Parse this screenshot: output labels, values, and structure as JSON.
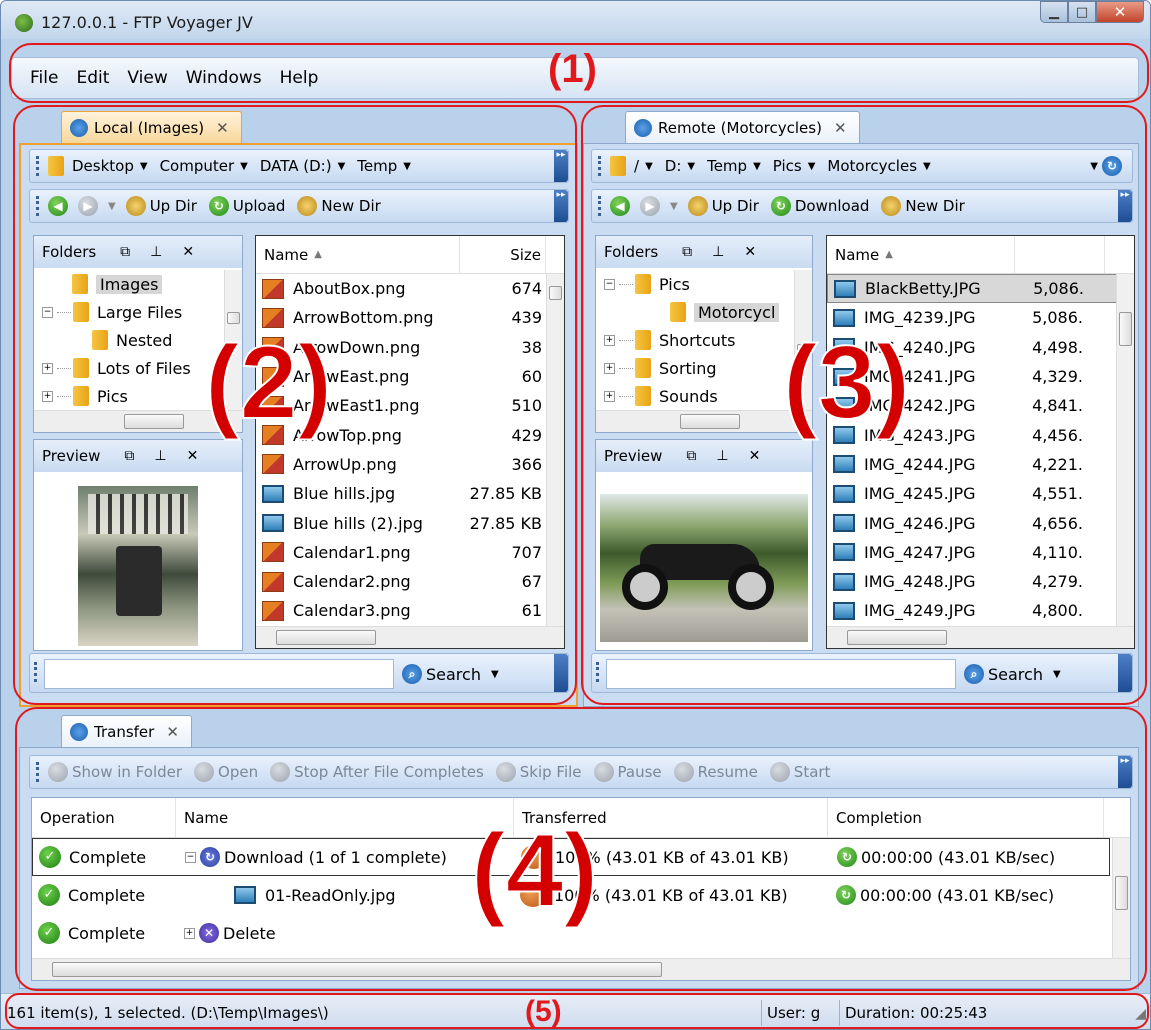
{
  "window": {
    "title": "127.0.0.1 - FTP Voyager JV"
  },
  "menu": [
    "File",
    "Edit",
    "View",
    "Windows",
    "Help"
  ],
  "local": {
    "tab_label": "Local (Images)",
    "path": [
      "Desktop",
      "Computer",
      "DATA (D:)",
      "Temp"
    ],
    "toolbar": {
      "up": "Up Dir",
      "upload": "Upload",
      "newdir": "New Dir"
    },
    "folders_title": "Folders",
    "folders": [
      {
        "label": "Images",
        "selected": true,
        "indent": 1
      },
      {
        "label": "Large Files",
        "indent": 0,
        "expander": "−"
      },
      {
        "label": "Nested",
        "indent": 2
      },
      {
        "label": "Lots of Files",
        "indent": 0,
        "expander": "+"
      },
      {
        "label": "Pics",
        "indent": 0,
        "expander": "+"
      }
    ],
    "preview_title": "Preview",
    "columns": {
      "name": "Name",
      "size": "Size"
    },
    "files": [
      {
        "name": "AboutBox.png",
        "size": "674",
        "type": "png"
      },
      {
        "name": "ArrowBottom.png",
        "size": "439",
        "type": "png"
      },
      {
        "name": "ArrowDown.png",
        "size": "38",
        "type": "png"
      },
      {
        "name": "ArrowEast.png",
        "size": "60",
        "type": "png"
      },
      {
        "name": "ArrowEast1.png",
        "size": "510",
        "type": "png"
      },
      {
        "name": "ArrowTop.png",
        "size": "429",
        "type": "png"
      },
      {
        "name": "ArrowUp.png",
        "size": "366",
        "type": "png"
      },
      {
        "name": "Blue hills.jpg",
        "size": "27.85 KB",
        "type": "jpg"
      },
      {
        "name": "Blue hills (2).jpg",
        "size": "27.85 KB",
        "type": "jpg"
      },
      {
        "name": "Calendar1.png",
        "size": "707",
        "type": "png"
      },
      {
        "name": "Calendar2.png",
        "size": "67",
        "type": "png"
      },
      {
        "name": "Calendar3.png",
        "size": "61",
        "type": "png"
      }
    ],
    "search_label": "Search"
  },
  "remote": {
    "tab_label": "Remote (Motorcycles)",
    "path": [
      "/",
      "D:",
      "Temp",
      "Pics",
      "Motorcycles"
    ],
    "toolbar": {
      "up": "Up Dir",
      "download": "Download",
      "newdir": "New Dir"
    },
    "folders_title": "Folders",
    "folders": [
      {
        "label": "Pics",
        "indent": 0,
        "expander": "−"
      },
      {
        "label": "Motorcycl",
        "indent": 2,
        "selected": true
      },
      {
        "label": "Shortcuts",
        "indent": 0,
        "expander": "+"
      },
      {
        "label": "Sorting",
        "indent": 0,
        "expander": "+"
      },
      {
        "label": "Sounds",
        "indent": 0,
        "expander": "+"
      }
    ],
    "preview_title": "Preview",
    "columns": {
      "name": "Name"
    },
    "files": [
      {
        "name": "BlackBetty.JPG",
        "size": "5,086.",
        "selected": true
      },
      {
        "name": "IMG_4239.JPG",
        "size": "5,086."
      },
      {
        "name": "IMG_4240.JPG",
        "size": "4,498."
      },
      {
        "name": "IMG_4241.JPG",
        "size": "4,329."
      },
      {
        "name": "IMG_4242.JPG",
        "size": "4,841."
      },
      {
        "name": "IMG_4243.JPG",
        "size": "4,456."
      },
      {
        "name": "IMG_4244.JPG",
        "size": "4,221."
      },
      {
        "name": "IMG_4245.JPG",
        "size": "4,551."
      },
      {
        "name": "IMG_4246.JPG",
        "size": "4,656."
      },
      {
        "name": "IMG_4247.JPG",
        "size": "4,110."
      },
      {
        "name": "IMG_4248.JPG",
        "size": "4,279."
      },
      {
        "name": "IMG_4249.JPG",
        "size": "4,800."
      }
    ],
    "search_label": "Search"
  },
  "transfer": {
    "tab_label": "Transfer",
    "toolbar": [
      "Show in Folder",
      "Open",
      "Stop After File Completes",
      "Skip File",
      "Pause",
      "Resume",
      "Start"
    ],
    "columns": [
      "Operation",
      "Name",
      "Transferred",
      "Completion"
    ],
    "rows": [
      {
        "operation": "Complete",
        "name": "Download  (1 of 1 complete)",
        "transferred": "100% (43.01 KB of 43.01 KB)",
        "completion": "00:00:00 (43.01 KB/sec)"
      },
      {
        "operation": "Complete",
        "name": "01-ReadOnly.jpg",
        "transferred": "100% (43.01 KB of 43.01 KB)",
        "completion": "00:00:00 (43.01 KB/sec)"
      },
      {
        "operation": "Complete",
        "name": "Delete",
        "transferred": "",
        "completion": ""
      }
    ]
  },
  "status": {
    "items": "161 item(s), 1 selected.  (D:\\Temp\\Images\\)",
    "user": "User:  g",
    "duration": "Duration:  00:25:43"
  },
  "annotations": [
    "(1)",
    "(2)",
    "(3)",
    "(4)",
    "(5)"
  ],
  "colors": {
    "accent": "#1e4d93",
    "annotation": "#e0191c",
    "tab_active": "#f0a030"
  }
}
